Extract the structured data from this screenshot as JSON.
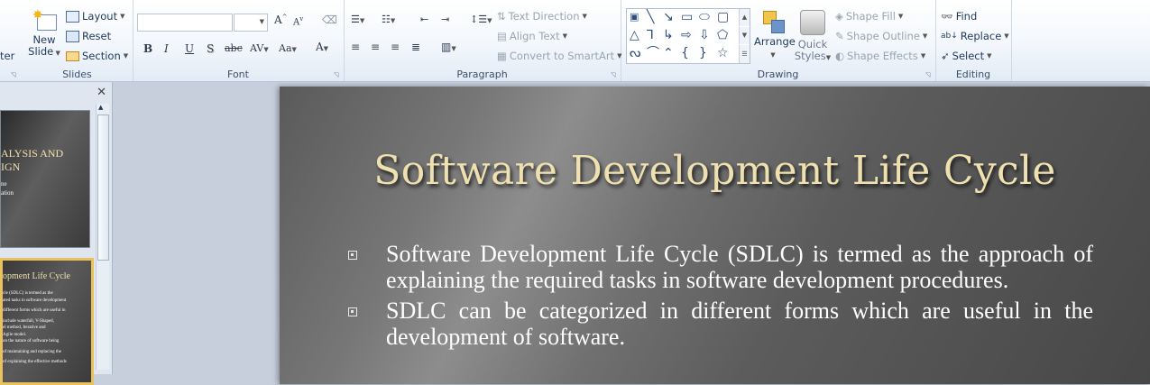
{
  "ribbon": {
    "slides": {
      "label": "Slides",
      "partial_left": "ter",
      "new_slide_line1": "New",
      "new_slide_line2": "Slide",
      "layout": "Layout",
      "reset": "Reset",
      "section": "Section"
    },
    "font": {
      "label": "Font",
      "bold": "B",
      "italic": "I",
      "underline": "U",
      "shadow": "S",
      "strikethrough": "abc",
      "char_spacing": "AV",
      "change_case": "Aa",
      "font_color": "A",
      "grow": "A",
      "shrink": "A"
    },
    "paragraph": {
      "label": "Paragraph",
      "text_direction": "Text Direction",
      "align_text": "Align Text",
      "convert_smartart": "Convert to SmartArt"
    },
    "drawing": {
      "label": "Drawing",
      "arrange": "Arrange",
      "quick_styles_line1": "Quick",
      "quick_styles_line2": "Styles",
      "shape_fill": "Shape Fill",
      "shape_outline": "Shape Outline",
      "shape_effects": "Shape Effects"
    },
    "editing": {
      "label": "Editing",
      "find": "Find",
      "replace": "Replace",
      "select": "Select"
    }
  },
  "thumbnails": [
    {
      "title_lines": [
        "ALYSIS  AND",
        "IGN"
      ],
      "sub_lines": [
        "ne",
        "ation"
      ]
    },
    {
      "title": "opment Life Cycle",
      "lines": [
        "cle (SDLC) is termed as the",
        "ated tasks in software development",
        "different forms which are useful in",
        "include waterfall, V-Shaped,",
        "el method, Iterative and",
        "Agile model.",
        "on the nature of software being",
        "of maintaining and replacing the",
        "of explaining the effective methods"
      ]
    }
  ],
  "slide": {
    "title": "Software Development Life Cycle",
    "bullets": [
      "Software  Development  Life  Cycle  (SDLC)  is termed as the approach  of explaining  the required  tasks  in software  development procedures.",
      "SDLC  can  be  categorized  in different  forms  which  are useful  in the development  of software."
    ]
  },
  "colors": {
    "title_gold": "#efe0b0",
    "selected_thumb_border": "#e9c25c",
    "ribbon_text": "#1e395b"
  }
}
